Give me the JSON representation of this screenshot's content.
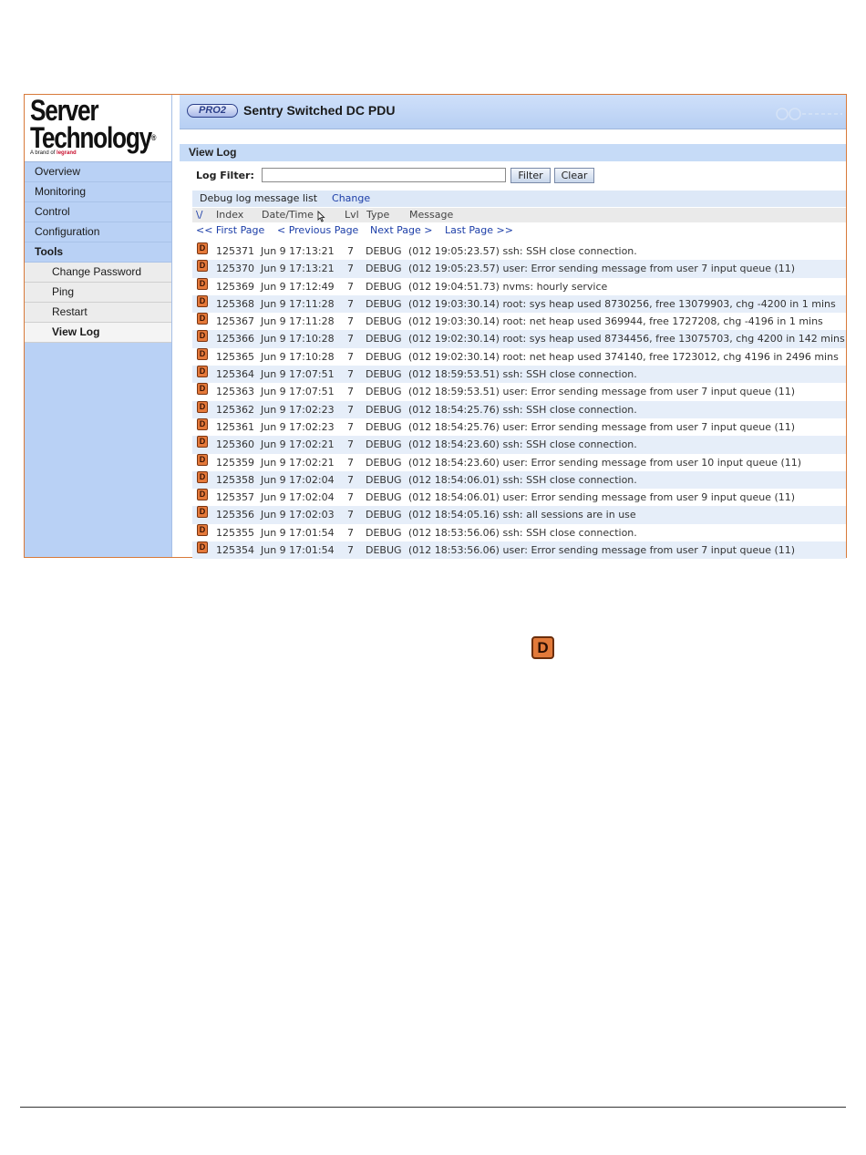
{
  "brand": {
    "line1": "Server",
    "line2": "Technology",
    "reg": "®",
    "brand_of": "A brand of",
    "legrand": "legrand"
  },
  "header": {
    "badge": "PRO2",
    "title": "Sentry Switched DC PDU"
  },
  "sidebar": {
    "items": [
      {
        "label": "Overview"
      },
      {
        "label": "Monitoring"
      },
      {
        "label": "Control"
      },
      {
        "label": "Configuration"
      },
      {
        "label": "Tools"
      }
    ],
    "subitems": [
      {
        "label": "Change Password"
      },
      {
        "label": "Ping"
      },
      {
        "label": "Restart"
      },
      {
        "label": "View Log",
        "active": true
      }
    ]
  },
  "page": {
    "section_title": "View Log"
  },
  "filter": {
    "label": "Log Filter:",
    "value": "",
    "filter_button": "Filter",
    "clear_button": "Clear"
  },
  "debug_bar": {
    "text": "Debug log message list",
    "change_link": "Change"
  },
  "columns": {
    "sort": "\\/",
    "index": "Index",
    "datetime": "Date/Time",
    "lvl": "Lvl",
    "type": "Type",
    "message": "Message"
  },
  "pager": {
    "first": "<< First Page",
    "previous": "< Previous Page",
    "next": "Next Page >",
    "last": "Last Page >>"
  },
  "icon_letter": "D",
  "log_rows": [
    {
      "index": "125371",
      "datetime": "Jun 9 17:13:21",
      "lvl": "7",
      "type": "DEBUG",
      "message": "(012 19:05:23.57) ssh: SSH close connection."
    },
    {
      "index": "125370",
      "datetime": "Jun 9 17:13:21",
      "lvl": "7",
      "type": "DEBUG",
      "message": "(012 19:05:23.57) user: Error sending message from user 7 input queue (11)"
    },
    {
      "index": "125369",
      "datetime": "Jun 9 17:12:49",
      "lvl": "7",
      "type": "DEBUG",
      "message": "(012 19:04:51.73) nvms: hourly service"
    },
    {
      "index": "125368",
      "datetime": "Jun 9 17:11:28",
      "lvl": "7",
      "type": "DEBUG",
      "message": "(012 19:03:30.14) root: sys heap used 8730256, free 13079903, chg -4200 in 1 mins"
    },
    {
      "index": "125367",
      "datetime": "Jun 9 17:11:28",
      "lvl": "7",
      "type": "DEBUG",
      "message": "(012 19:03:30.14) root: net heap used 369944, free 1727208, chg -4196 in 1 mins"
    },
    {
      "index": "125366",
      "datetime": "Jun 9 17:10:28",
      "lvl": "7",
      "type": "DEBUG",
      "message": "(012 19:02:30.14) root: sys heap used 8734456, free 13075703, chg 4200 in 142 mins"
    },
    {
      "index": "125365",
      "datetime": "Jun 9 17:10:28",
      "lvl": "7",
      "type": "DEBUG",
      "message": "(012 19:02:30.14) root: net heap used 374140, free 1723012, chg 4196 in 2496 mins"
    },
    {
      "index": "125364",
      "datetime": "Jun 9 17:07:51",
      "lvl": "7",
      "type": "DEBUG",
      "message": "(012 18:59:53.51) ssh: SSH close connection."
    },
    {
      "index": "125363",
      "datetime": "Jun 9 17:07:51",
      "lvl": "7",
      "type": "DEBUG",
      "message": "(012 18:59:53.51) user: Error sending message from user 7 input queue (11)"
    },
    {
      "index": "125362",
      "datetime": "Jun 9 17:02:23",
      "lvl": "7",
      "type": "DEBUG",
      "message": "(012 18:54:25.76) ssh: SSH close connection."
    },
    {
      "index": "125361",
      "datetime": "Jun 9 17:02:23",
      "lvl": "7",
      "type": "DEBUG",
      "message": "(012 18:54:25.76) user: Error sending message from user 7 input queue (11)"
    },
    {
      "index": "125360",
      "datetime": "Jun 9 17:02:21",
      "lvl": "7",
      "type": "DEBUG",
      "message": "(012 18:54:23.60) ssh: SSH close connection."
    },
    {
      "index": "125359",
      "datetime": "Jun 9 17:02:21",
      "lvl": "7",
      "type": "DEBUG",
      "message": "(012 18:54:23.60) user: Error sending message from user 10 input queue (11)"
    },
    {
      "index": "125358",
      "datetime": "Jun 9 17:02:04",
      "lvl": "7",
      "type": "DEBUG",
      "message": "(012 18:54:06.01) ssh: SSH close connection."
    },
    {
      "index": "125357",
      "datetime": "Jun 9 17:02:04",
      "lvl": "7",
      "type": "DEBUG",
      "message": "(012 18:54:06.01) user: Error sending message from user 9 input queue (11)"
    },
    {
      "index": "125356",
      "datetime": "Jun 9 17:02:03",
      "lvl": "7",
      "type": "DEBUG",
      "message": "(012 18:54:05.16) ssh: all sessions are in use"
    },
    {
      "index": "125355",
      "datetime": "Jun 9 17:01:54",
      "lvl": "7",
      "type": "DEBUG",
      "message": "(012 18:53:56.06) ssh: SSH close connection."
    },
    {
      "index": "125354",
      "datetime": "Jun 9 17:01:54",
      "lvl": "7",
      "type": "DEBUG",
      "message": "(012 18:53:56.06) user: Error sending message from user 7 input queue (11)"
    }
  ],
  "colors": {
    "sidebar_bg": "#b9d1f5",
    "header_bg": "#c6dbf7",
    "link": "#1c3ea8",
    "debug_icon": "#e5793a",
    "frame_border": "#d87a3a"
  }
}
